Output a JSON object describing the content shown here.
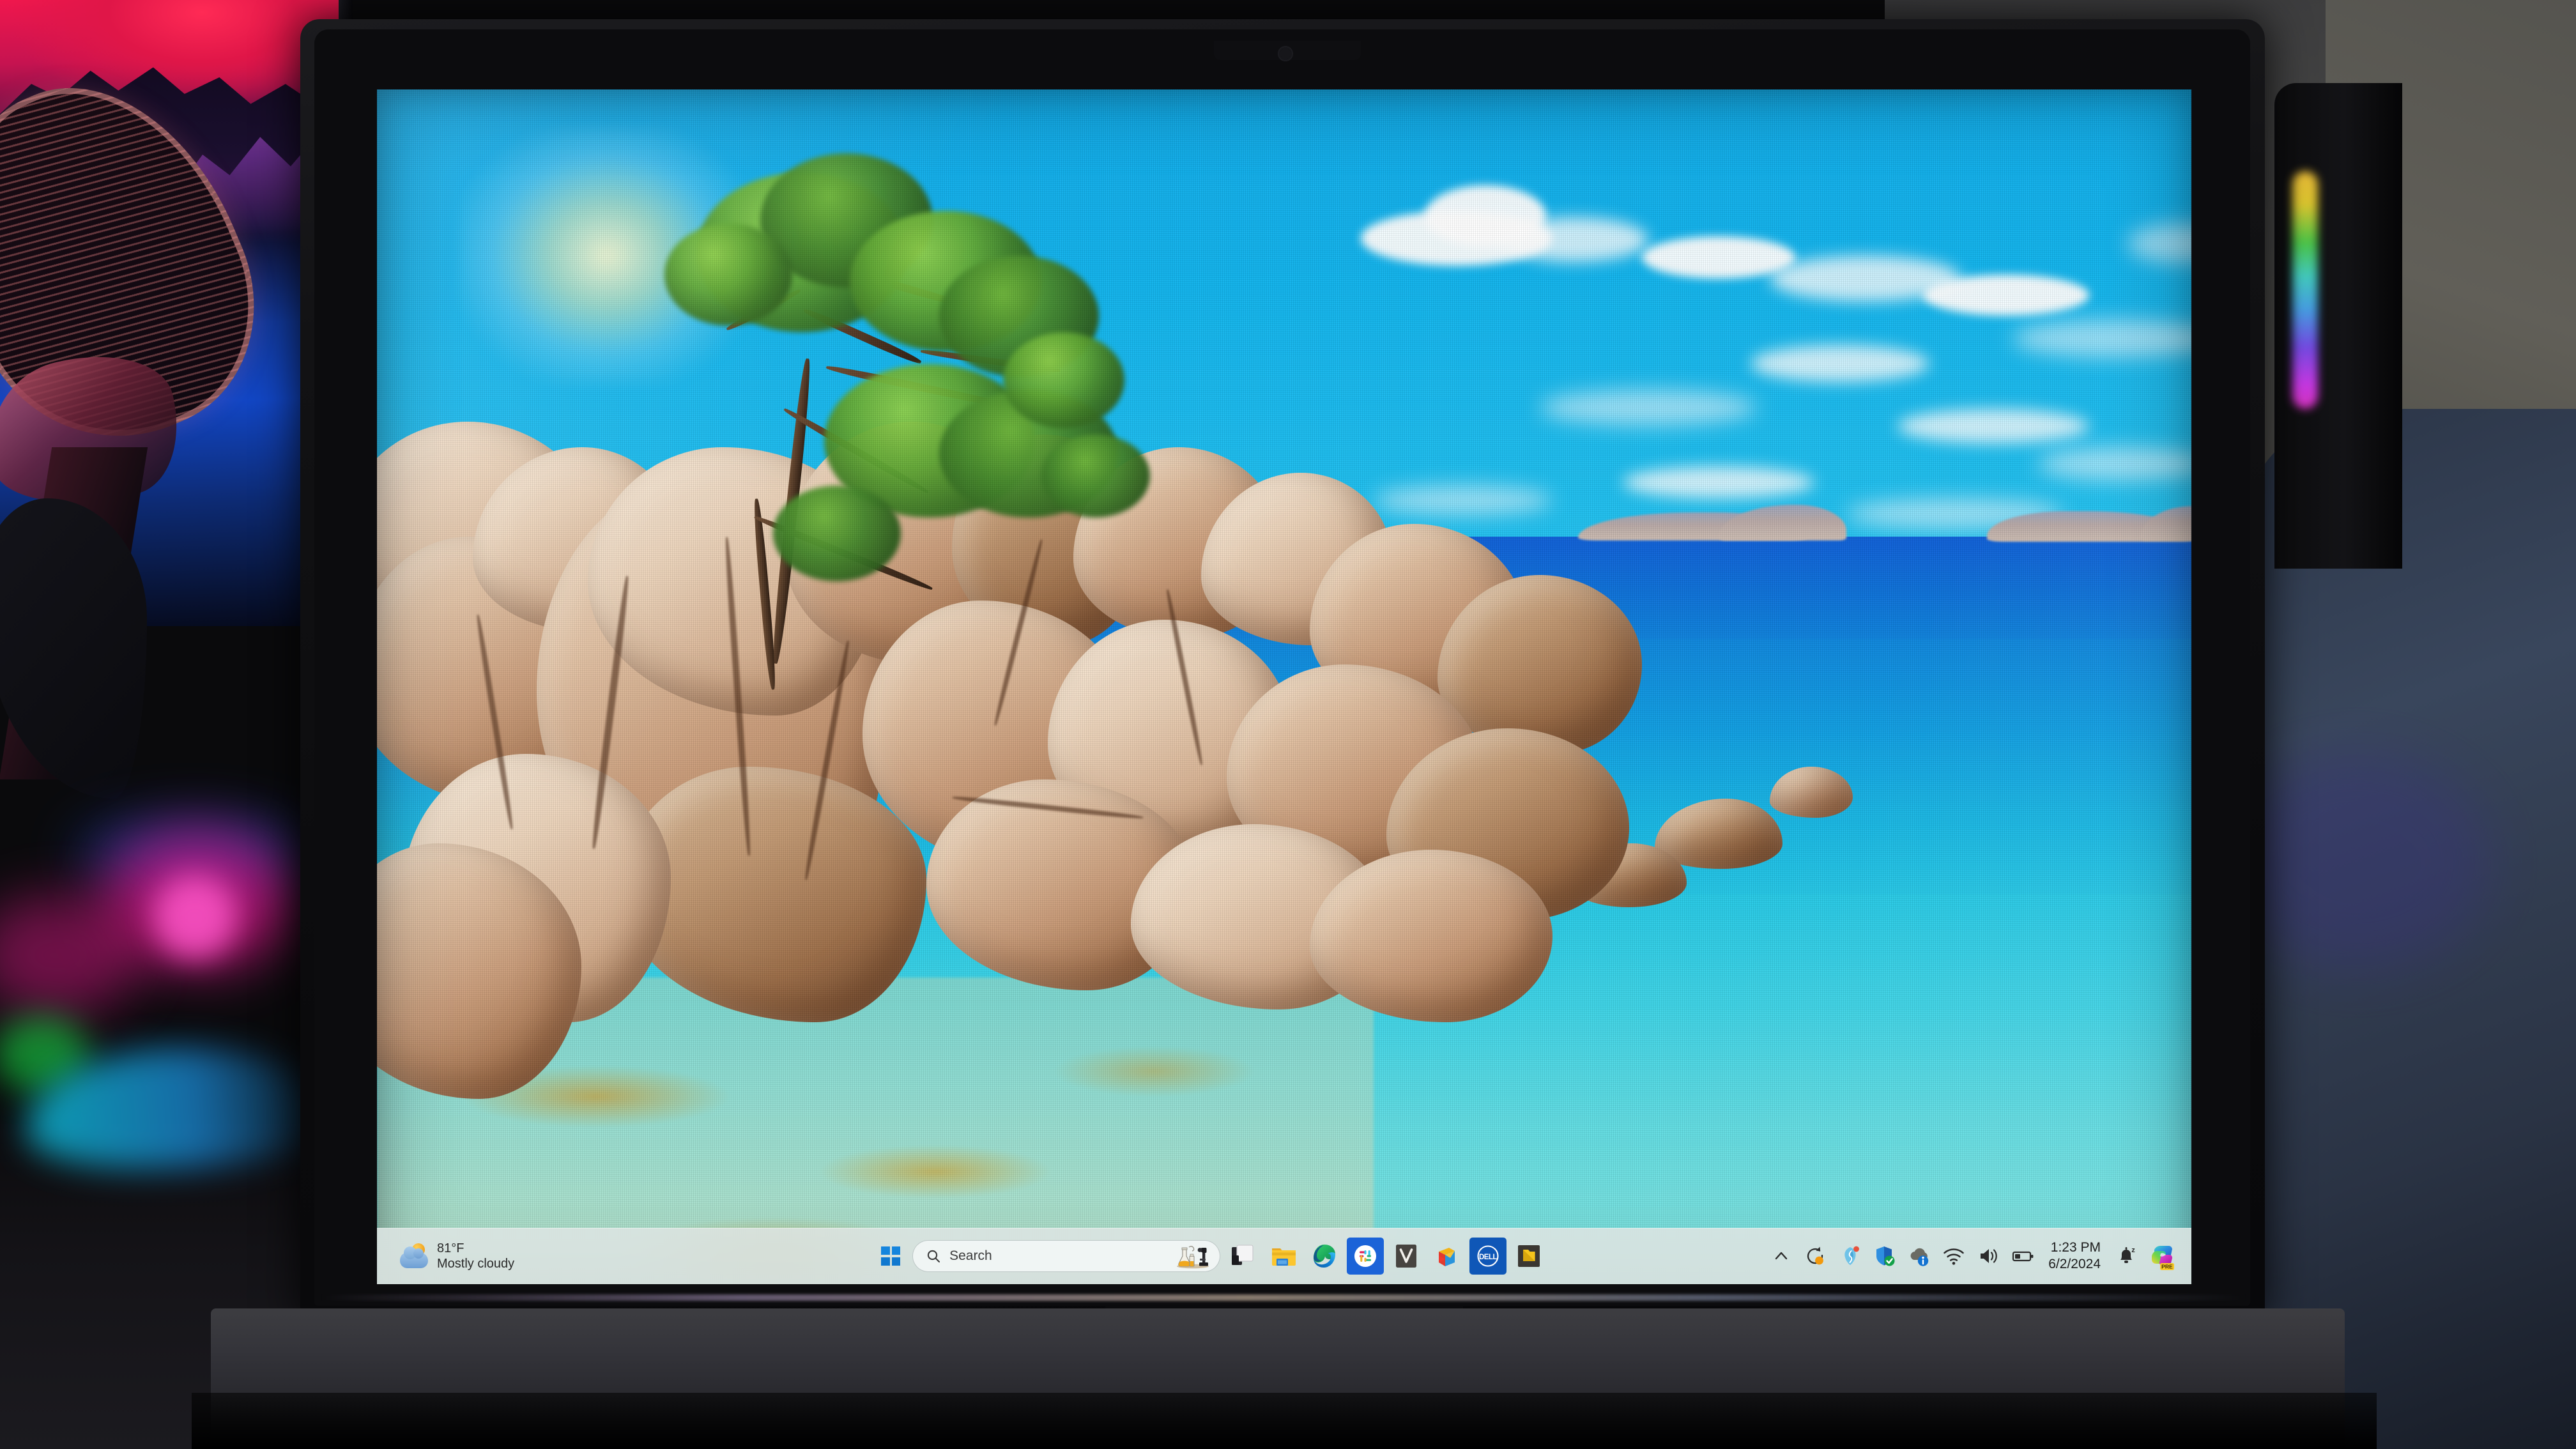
{
  "scene": {
    "description": "Laptop on a desk in a dark RGB-lit room showing Windows 11 desktop",
    "device": "laptop",
    "os": "Windows 11"
  },
  "wallpaper": {
    "name": "coastal-rocks-pine-tree",
    "sky_color": "#14b3ec",
    "sea_deep_color": "#0e5fd8",
    "sea_shallow_color": "#3ed4e6",
    "rock_color": "#e2c2a4",
    "foliage_color": "#5fa832"
  },
  "taskbar": {
    "background_color": "#dce4e2",
    "weather": {
      "temperature": "81°F",
      "condition": "Mostly cloudy",
      "icon": "partly-cloudy-icon"
    },
    "start": {
      "label": "Start",
      "icon": "windows-logo-icon"
    },
    "search": {
      "placeholder": "Search",
      "icon": "search-icon",
      "secondary_icon": "science-lab-icon"
    },
    "pinned_apps": [
      {
        "name": "Task View",
        "icon": "task-view-icon"
      },
      {
        "name": "File Explorer",
        "icon": "file-explorer-icon"
      },
      {
        "name": "Microsoft Edge",
        "icon": "edge-icon"
      },
      {
        "name": "Slack",
        "icon": "slack-icon"
      },
      {
        "name": "V App",
        "icon": "v-app-icon"
      },
      {
        "name": "Cube App",
        "icon": "cube-app-icon"
      },
      {
        "name": "Dell",
        "icon": "dell-icon"
      },
      {
        "name": "Folder App",
        "icon": "folder-app-icon"
      }
    ],
    "tray": [
      {
        "name": "Show hidden icons",
        "icon": "chevron-up-icon"
      },
      {
        "name": "Updates",
        "icon": "sync-update-icon",
        "badge_color": "#f59e0b"
      },
      {
        "name": "Support Assist",
        "icon": "support-icon",
        "badge_color": "#e8513a"
      },
      {
        "name": "Windows Security",
        "icon": "shield-check-icon",
        "badge_color": "#13a149"
      },
      {
        "name": "Weather info",
        "icon": "cloud-info-icon",
        "badge_color": "#1272d0"
      },
      {
        "name": "Network",
        "icon": "wifi-icon"
      },
      {
        "name": "Volume",
        "icon": "speaker-icon"
      },
      {
        "name": "Battery",
        "icon": "battery-icon"
      }
    ],
    "clock": {
      "time": "1:23 PM",
      "date": "6/2/2024"
    },
    "notifications": {
      "name": "Do not disturb",
      "icon": "bell-sleep-icon"
    },
    "copilot": {
      "name": "Copilot",
      "icon": "copilot-icon",
      "badge": "PRE"
    }
  },
  "room": {
    "left_art": {
      "name": "gradient-wall-art",
      "colors": [
        "#f0174d",
        "#1246c4",
        "#060a1c"
      ]
    },
    "left_chair": {
      "name": "mesh-office-chair"
    },
    "rgb_lights": [
      {
        "name": "magenta-glow",
        "color": "#ff1aa0"
      },
      {
        "name": "green-led",
        "color": "#19e84a"
      },
      {
        "name": "cyan-light-strip",
        "color": "#0ed8f5"
      }
    ],
    "right_tower": {
      "name": "rgb-speaker-tower",
      "strip_colors": [
        "#f5c33a",
        "#4fcf4a",
        "#46d6c8",
        "#4aa8f0",
        "#7a4ef0",
        "#e236c6"
      ]
    },
    "right_chair": {
      "name": "blue-armchair",
      "color": "#39465c"
    },
    "wall_color": "#4a4a48"
  }
}
